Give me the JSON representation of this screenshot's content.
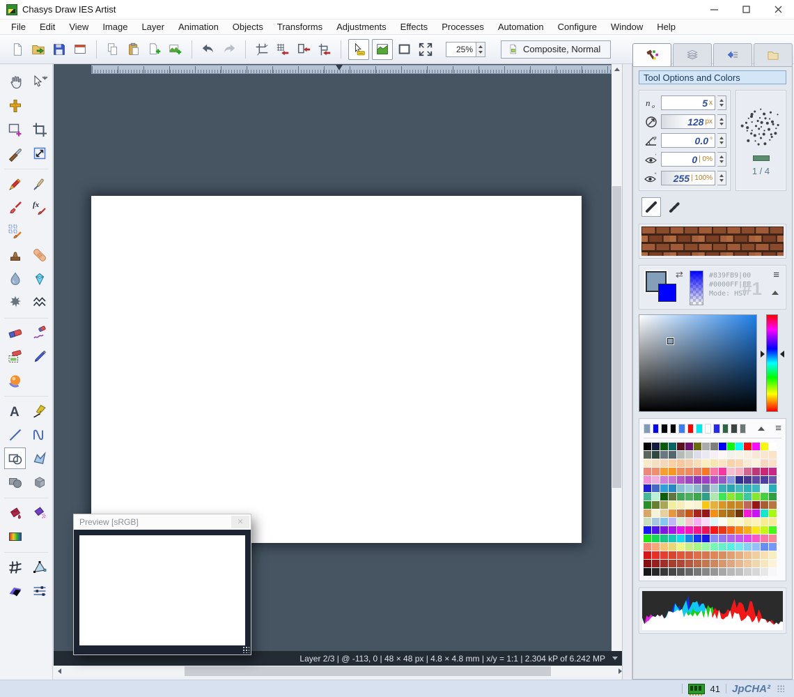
{
  "window": {
    "title": "Chasys Draw IES Artist",
    "controls": [
      "minimize",
      "maximize",
      "close"
    ]
  },
  "menu": {
    "items": [
      "File",
      "Edit",
      "View",
      "Image",
      "Layer",
      "Animation",
      "Objects",
      "Transforms",
      "Adjustments",
      "Effects",
      "Processes",
      "Automation",
      "Configure",
      "Window",
      "Help"
    ]
  },
  "toolbar": {
    "zoom_value": "25%",
    "composite_label": "Composite, Normal",
    "groups": [
      [
        "new-file",
        "open-folder",
        "save",
        "new-window"
      ],
      [
        "copy",
        "paste",
        "add-page",
        "add-image"
      ],
      [
        "undo",
        "redo"
      ],
      [
        "canvas-size",
        "snap-grid",
        "snap-object",
        "snap-guide"
      ],
      [
        "pointer-options",
        "preview-toggle",
        "frame-view",
        "fullscreen"
      ]
    ],
    "framed_buttons": [
      "pointer-options",
      "preview-toggle"
    ]
  },
  "side_tabs": {
    "tabs": [
      "tool-options",
      "layers",
      "steps",
      "files"
    ],
    "active": "tool-options"
  },
  "left_toolbar": {
    "active": "shapes",
    "groups": [
      [
        [
          "pan-hand",
          "move-tool"
        ],
        [
          "measure-cross",
          null
        ],
        [
          "select-rectangle",
          "crop"
        ],
        [
          "knife",
          "free-transform"
        ]
      ],
      [
        [
          "pencil",
          "color-picker"
        ],
        [
          "paintbrush",
          "fx-brush"
        ],
        [
          "pattern-brush",
          null
        ],
        [
          "clone-stamp",
          "heal-patch"
        ],
        [
          "water-drop",
          "sharpen-diamond"
        ],
        [
          "splatter",
          "smudge"
        ]
      ],
      [
        [
          "eraser",
          "eraser-pen"
        ],
        [
          "background-eraser",
          "marker-pen"
        ],
        [
          "render-sphere",
          null
        ]
      ],
      [
        [
          "text",
          "calligraphy-pen"
        ],
        [
          "line",
          "curve"
        ],
        [
          "shapes",
          "polygon"
        ],
        [
          "solid-shapes",
          "cube"
        ]
      ],
      [
        [
          "fill-bucket",
          "pattern-fill"
        ],
        [
          "gradient-fill",
          null
        ]
      ],
      [
        [
          "mesh-distort",
          "warp-mesh"
        ],
        [
          "shading",
          "adjustments"
        ]
      ]
    ]
  },
  "panel": {
    "header": "Tool Options and Colors",
    "options": {
      "rows": [
        {
          "icon": "count-icon",
          "value": "5",
          "unit": "x"
        },
        {
          "icon": "diameter-icon",
          "value": "128",
          "unit": "px"
        },
        {
          "icon": "angle-icon",
          "value": "0.0",
          "unit": "°"
        },
        {
          "icon": "threshold-low-icon",
          "value": "0",
          "unit": "| 0%"
        },
        {
          "icon": "threshold-high-icon",
          "value": "255",
          "unit": "| 100%"
        }
      ],
      "brush_page": "1 / 4"
    },
    "stroke_modes": [
      "solid-stroke",
      "dashed-stroke"
    ],
    "color_info": {
      "fg_hex": "#839FB9|00",
      "bg_hex": "#0000FF|FF",
      "mode": "Mode: HSV",
      "slot": "#1",
      "fg_color": "#839FB9",
      "bg_color": "#0000FF",
      "hue_color": "#1F7FE8"
    },
    "palette": {
      "recent": [
        "#7F9BB5",
        "#0404EC",
        "#000000",
        "#000000",
        "#3C7CF0",
        "#F00404",
        "#04E8EC",
        "#FFFFFF",
        "#2428F0",
        "#2C6444",
        "#3C4440",
        "#6C7670"
      ],
      "grid": [
        [
          "#000000",
          "#101C3C",
          "#0A5A0A",
          "#0A6464",
          "#5A0F1E",
          "#6E106E",
          "#6A6A10",
          "#AAAAAA",
          "#7E7E7E",
          "#0000F8",
          "#0CF80C",
          "#0CF8F8",
          "#F80C0C",
          "#F80CF8",
          "#F8F80C",
          "#FFFFFF"
        ],
        [
          "#59655D",
          "#2E4A40",
          "#69787E",
          "#57666C",
          "#B5BAB6",
          "#C7CBC7",
          "#DCDCE8",
          "#EAE8F2",
          "#F7EFF5",
          "#FBF7F7",
          "#F3F3EB",
          "#F7F3E7",
          "#FBEFDF",
          "#F7E7D7",
          "#FBE7CF",
          "#FBE3C7"
        ],
        [
          "#FAE9C9",
          "#F7E0C1",
          "#F7D7B7",
          "#F9CFA7",
          "#F7C79F",
          "#F5D0AF",
          "#F7E0B7",
          "#FBEFBF",
          "#F7E7AF",
          "#FBE3C3",
          "#F7D3AB",
          "#F9D7B3",
          "#F7EBD3",
          "#FBF3DB",
          "#F7D7BF",
          "#FBDFC7"
        ],
        [
          "#EE8777",
          "#EE8F6F",
          "#F69F2F",
          "#F6971F",
          "#EE8F5F",
          "#EE8B63",
          "#EE7F67",
          "#F67727",
          "#F677A7",
          "#F6379F",
          "#F6BFCF",
          "#F6AFBF",
          "#CF678F",
          "#BF3777",
          "#CB2777",
          "#C72787"
        ],
        [
          "#EE8FD7",
          "#EEAFDF",
          "#CF7FD7",
          "#C777CF",
          "#B757C7",
          "#9F47BF",
          "#8F37B7",
          "#9F3FC7",
          "#AF4FC7",
          "#9757C7",
          "#8797DF",
          "#2F2F8F",
          "#47378F",
          "#5F47A7",
          "#4F3F9F",
          "#6757AF"
        ],
        [
          "#1F1FCF",
          "#4767C7",
          "#2F9FD7",
          "#2787C7",
          "#87BFD7",
          "#9FCFDF",
          "#8FB7CF",
          "#6787A7",
          "#A7C7D7",
          "#37AFB7",
          "#27A7AF",
          "#47B7BF",
          "#2FAFB7",
          "#3FB7BF",
          "#DFF3F7",
          "#27AFB7"
        ],
        [
          "#47B797",
          "#B7EFD7",
          "#0F5F0F",
          "#5F773F",
          "#3FA757",
          "#4FAF5F",
          "#3FA74F",
          "#2F9F87",
          "#AFE7AF",
          "#3FE757",
          "#8FE72F",
          "#57DF47",
          "#3FC79F",
          "#87E72F",
          "#47CF3F",
          "#2F9F3F"
        ],
        [
          "#278F27",
          "#677F2F",
          "#A7A757",
          "#EFEF9F",
          "#F7EFB7",
          "#FBF7D7",
          "#F7F3CF",
          "#F7C717",
          "#E7AF3F",
          "#D79727",
          "#C7871F",
          "#C78727",
          "#BF6757",
          "#971717",
          "#A75F2F",
          "#B7773F"
        ],
        [
          "#D7A767",
          "#F7F3D7",
          "#E7CF9F",
          "#E7973F",
          "#BF7747",
          "#C75717",
          "#A7271F",
          "#971717",
          "#F78F17",
          "#B77717",
          "#A76717",
          "#6F3707",
          "#F717D7",
          "#C717F7",
          "#17E7C7",
          "#A7F717"
        ],
        [
          "#C7DFBF",
          "#A7C7DF",
          "#87C7EF",
          "#BFB7F7",
          "#D7EFCF",
          "#F7C7CF",
          "#F7AFEF",
          "#FBD7FB",
          "#DFF7FB",
          "#FBFBEF",
          "#F7F7BF",
          "#FBF7CF",
          "#F7EFA7",
          "#FBF3B7",
          "#F7EF8F",
          "#F7EB97"
        ],
        [
          "#1717F7",
          "#4F17E7",
          "#7F17DF",
          "#A717E7",
          "#E717E7",
          "#F717B7",
          "#F71787",
          "#E71757",
          "#F71717",
          "#E73717",
          "#F75F17",
          "#F78B17",
          "#F7AF17",
          "#F7E717",
          "#C7F717",
          "#47F717"
        ],
        [
          "#17E717",
          "#17D757",
          "#17C787",
          "#17C7B7",
          "#17D7EF",
          "#1787E7",
          "#1737F7",
          "#1717E7",
          "#878FF7",
          "#9777EF",
          "#AF67EF",
          "#C757EF",
          "#E747E7",
          "#F757C7",
          "#F777A7",
          "#F78797"
        ],
        [
          "#F78777",
          "#F7A777",
          "#F7C777",
          "#E7D777",
          "#EFF787",
          "#C7EF87",
          "#A7F787",
          "#97F7A7",
          "#77F7B7",
          "#67EFC7",
          "#57EFDF",
          "#77E7EF",
          "#87CFF7",
          "#97BFF7",
          "#678FEF",
          "#7797F7"
        ],
        [
          "#D71717",
          "#E72F27",
          "#E73F2F",
          "#D7472F",
          "#DF5737",
          "#D75F3F",
          "#DF6F47",
          "#D7774F",
          "#DF8757",
          "#D78F5F",
          "#DF9F6F",
          "#E7AF7F",
          "#EFBF8F",
          "#EFCF9F",
          "#F7DFAF",
          "#F7EFBF"
        ],
        [
          "#870F0F",
          "#971F1F",
          "#9F2F27",
          "#A73F2F",
          "#AF4737",
          "#B7573F",
          "#BF6747",
          "#C7774F",
          "#CF875F",
          "#D7976F",
          "#DFA77F",
          "#E7B78F",
          "#EFC79F",
          "#EFD7AF",
          "#F7E7BF",
          "#FBF3D7"
        ],
        [
          "#171717",
          "#272727",
          "#373737",
          "#474747",
          "#575757",
          "#676767",
          "#777777",
          "#878787",
          "#979797",
          "#A7A7A7",
          "#B7B7B7",
          "#BFBFBF",
          "#CFCFCF",
          "#D7D7D7",
          "#E7E7E7",
          "#F7F7F7"
        ]
      ]
    },
    "histogram_colors": [
      "#1030e8",
      "#10c8f0",
      "#18d018",
      "#e820e8",
      "#f01818",
      "#ffffff"
    ]
  },
  "preview_window": {
    "title": "Preview [sRGB]"
  },
  "canvas": {
    "status_text": "Layer 2/3 | @ -113, 0 | 48 × 48 px | 4.8 × 4.8 mm | x/y = 1:1 | 2.304 kP of 6.242 MP"
  },
  "bottom_bar": {
    "memory_value": "41",
    "brand": "JpCHA²"
  }
}
